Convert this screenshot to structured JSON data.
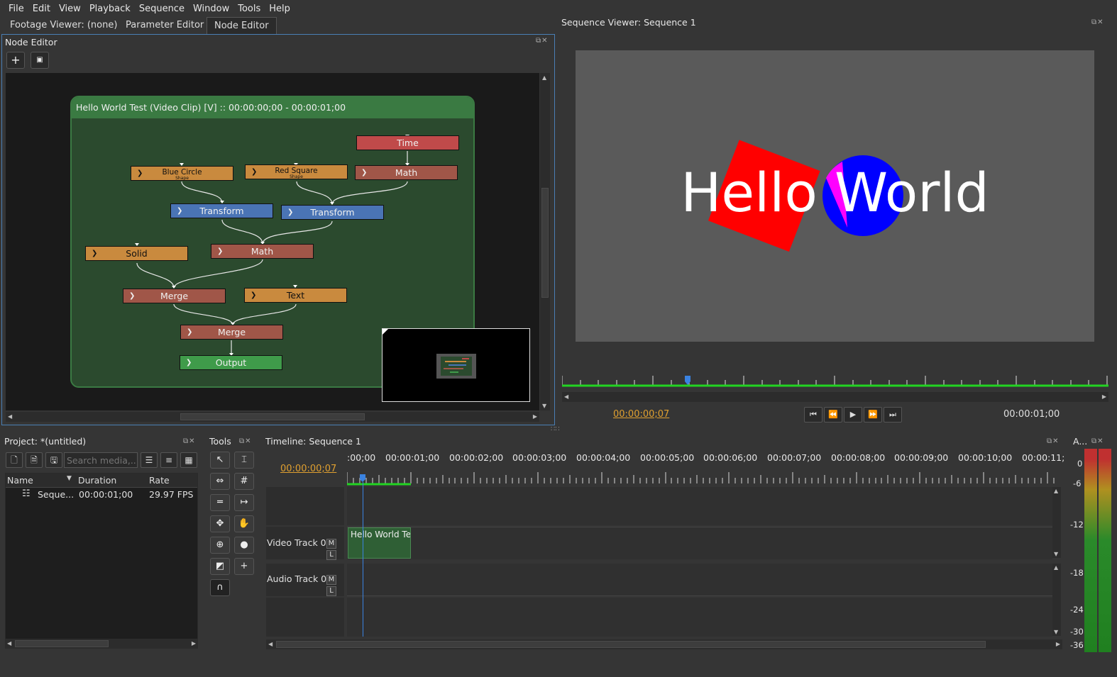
{
  "menubar": {
    "items": [
      "File",
      "Edit",
      "View",
      "Playback",
      "Sequence",
      "Window",
      "Tools",
      "Help"
    ]
  },
  "tabs": [
    {
      "label": "Footage Viewer: (none)",
      "active": false
    },
    {
      "label": "Parameter Editor",
      "active": false
    },
    {
      "label": "Node Editor",
      "active": true
    }
  ],
  "node_editor": {
    "title": "Node Editor",
    "toolbar_icons": [
      "add-node-icon",
      "fit-view-icon"
    ],
    "group_header": "Hello World Test (Video Clip) [V] :: 00:00:00;00 - 00:00:01;00",
    "nodes": {
      "time": "Time",
      "math_top": "Math",
      "blue_circle": "Blue Circle",
      "blue_circle_sub": "Shape",
      "red_square": "Red Square",
      "red_square_sub": "Shape",
      "transform1": "Transform",
      "transform2": "Transform",
      "solid": "Solid",
      "math_mid": "Math",
      "merge1": "Merge",
      "text": "Text",
      "merge2": "Merge",
      "output": "Output"
    }
  },
  "sequence_viewer": {
    "title": "Sequence Viewer: Sequence 1",
    "preview_text": "Hello World",
    "current_time": "00:00:00;07",
    "end_time": "00:00:01;00",
    "playhead_progress": 0.23,
    "colors": {
      "red_square": "#ff0000",
      "blue_circle": "#0000ff",
      "overlap": "#ff00ff",
      "background": "#5a5a5a",
      "progress_line": "#22d422"
    }
  },
  "project": {
    "title": "Project: *(untitled)",
    "search_placeholder": "Search media,...",
    "columns": [
      "Name",
      "Duration",
      "Rate"
    ],
    "rows": [
      {
        "name": "Seque...",
        "duration": "00:00:01;00",
        "rate": "29.97 FPS"
      }
    ]
  },
  "tools": {
    "title": "Tools",
    "icons": [
      "pointer-icon",
      "edit-text-cursor-icon",
      "ripple-icon",
      "rolling-icon",
      "razor-icon",
      "slip-icon",
      "slide-icon",
      "hand-icon",
      "zoom-icon",
      "record-icon",
      "transition-icon",
      "add-icon",
      "audio-headphones-icon"
    ]
  },
  "timeline": {
    "title": "Timeline: Sequence 1",
    "current_time": "00:00:00;07",
    "ruler_labels": [
      ":00;00",
      "00:00:01;00",
      "00:00:02;00",
      "00:00:03;00",
      "00:00:04;00",
      "00:00:05;00",
      "00:00:06;00",
      "00:00:07;00",
      "00:00:08;00",
      "00:00:09;00",
      "00:00:10;00",
      "00:00:11;"
    ],
    "video_track": "Video Track 0",
    "audio_track": "Audio Track 0",
    "mute_label": "M",
    "lock_label": "L",
    "clip_label": "Hello World Te"
  },
  "audio_meter": {
    "title": "A...",
    "labels": [
      "0",
      "-6",
      "-12",
      "-18",
      "-24",
      "-30",
      "-36"
    ]
  }
}
